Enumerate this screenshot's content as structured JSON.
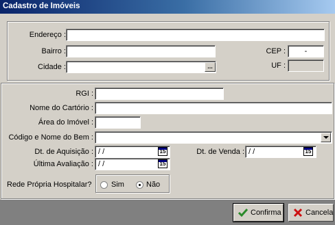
{
  "window": {
    "title": "Cadastro de Imóveis"
  },
  "address": {
    "endereco_label": "Endereço :",
    "endereco_value": "",
    "bairro_label": "Bairro :",
    "bairro_value": "",
    "cep_label": "CEP :",
    "cep_value": "-",
    "cidade_label": "Cidade :",
    "cidade_value": "",
    "cidade_lookup_label": "...",
    "uf_label": "UF :",
    "uf_value": ""
  },
  "details": {
    "rgi_label": "RGI :",
    "rgi_value": "",
    "cartorio_label": "Nome do Cartório :",
    "cartorio_value": "",
    "area_label": "Área do Imóvel :",
    "area_value": "",
    "bem_label": "Código e Nome do Bem :",
    "bem_value": "",
    "aquisicao_label": "Dt. de Aquisição :",
    "aquisicao_value": "/ /",
    "venda_label": "Dt. de Venda :",
    "venda_value": "/ /",
    "avaliacao_label": "Última Avaliação :",
    "avaliacao_value": "/ /",
    "calendar_glyph": "15",
    "rede_label": "Rede Própria Hospitalar?",
    "rede_options": [
      "Sim",
      "Não"
    ],
    "rede_selected": "Não"
  },
  "actions": {
    "confirma_label": "Confirma",
    "cancela_label": "Cancela"
  },
  "icons": {
    "confirma": "check-icon",
    "cancela": "x-icon",
    "calendar": "calendar-icon",
    "dropdown": "dropdown-arrow-icon"
  },
  "colors": {
    "titlebar_start": "#0a246a",
    "titlebar_end": "#a6caf0",
    "face": "#d4d0c8",
    "bottombar": "#808080",
    "check": "#2a8a2a",
    "cancel": "#cc1010"
  }
}
